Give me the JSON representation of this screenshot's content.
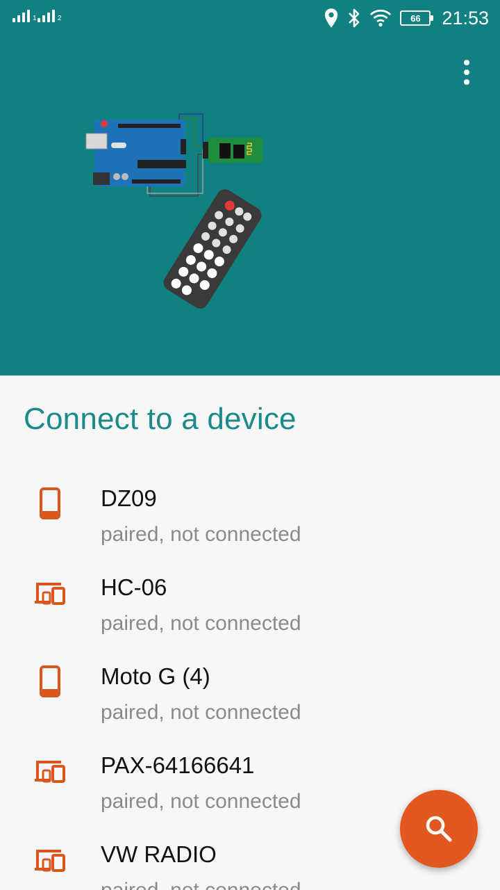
{
  "status_bar": {
    "sim1_label": "1",
    "sim2_label": "2",
    "battery_level": "66",
    "time": "21:53"
  },
  "header": {
    "overflow_menu_icon": "more-vert-icon",
    "illustration": "arduino-bluetooth-ir-remote"
  },
  "main": {
    "title": "Connect to a device",
    "devices": [
      {
        "name": "DZ09",
        "status": "paired, not connected",
        "icon": "phone-icon"
      },
      {
        "name": "HC-06",
        "status": "paired, not connected",
        "icon": "devices-icon"
      },
      {
        "name": "Moto G (4)",
        "status": "paired, not connected",
        "icon": "phone-icon"
      },
      {
        "name": "PAX-64166641",
        "status": "paired, not connected",
        "icon": "devices-icon"
      },
      {
        "name": "VW RADIO",
        "status": "paired, not connected",
        "icon": "devices-icon"
      }
    ]
  },
  "fab": {
    "icon": "search-icon"
  },
  "colors": {
    "primary": "#118080",
    "title": "#1a8b8a",
    "accent": "#e35820",
    "icon": "#d9561c"
  }
}
